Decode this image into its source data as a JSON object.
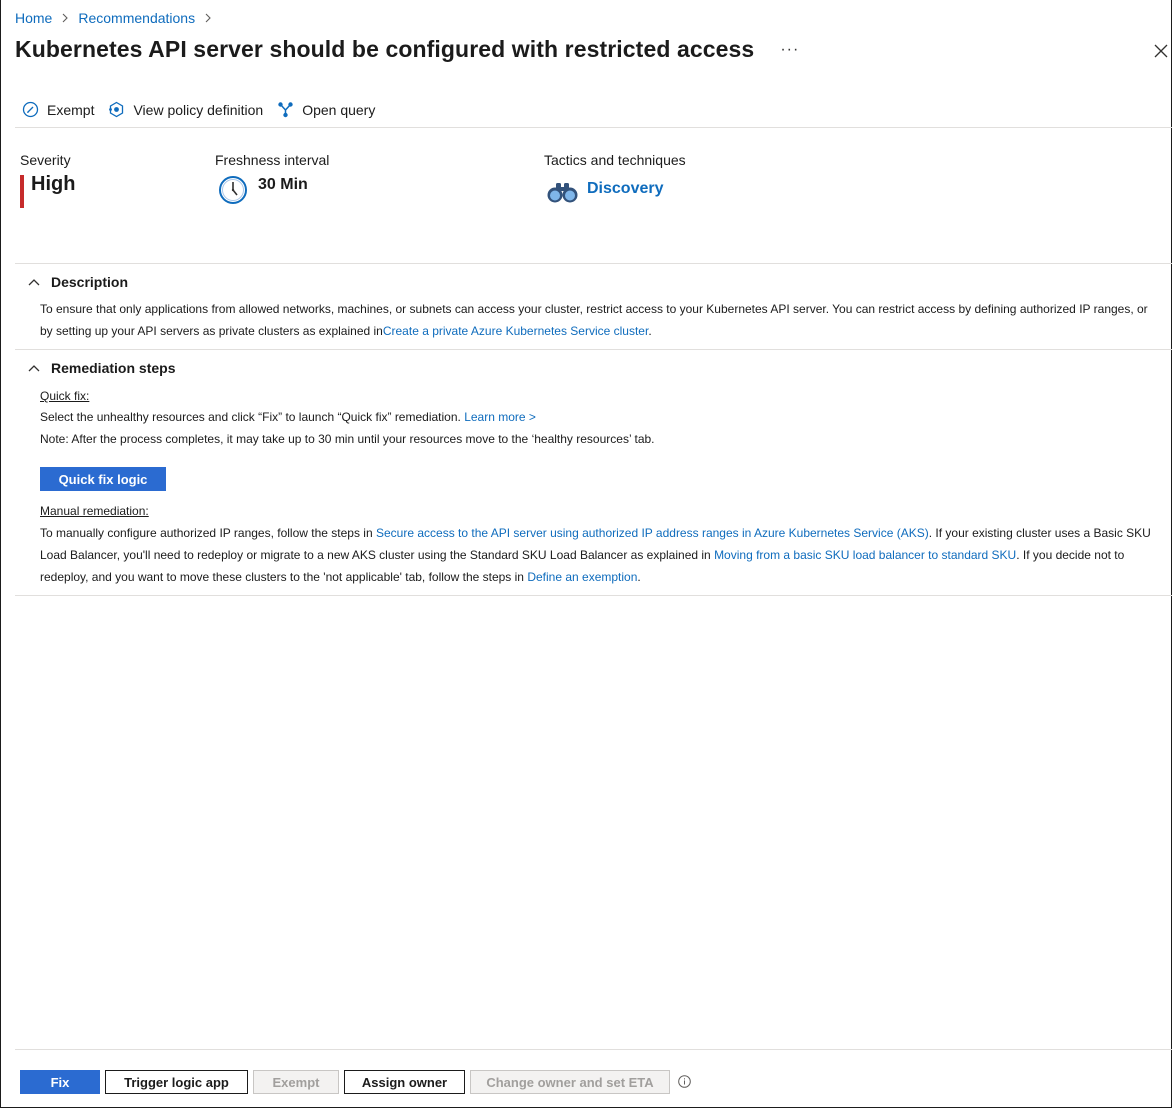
{
  "breadcrumb": {
    "home": "Home",
    "recommendations": "Recommendations"
  },
  "title": "Kubernetes API server should be configured with restricted access",
  "more_label": "···",
  "toolbar": {
    "exempt": "Exempt",
    "view_policy": "View policy definition",
    "open_query": "Open query"
  },
  "info": {
    "severity_label": "Severity",
    "severity_value": "High",
    "freshness_label": "Freshness interval",
    "freshness_value": "30 Min",
    "tactics_label": "Tactics and techniques",
    "tactics_value": "Discovery"
  },
  "description": {
    "heading": "Description",
    "text": "To ensure that only applications from allowed networks, machines, or subnets can access your cluster, restrict access to your Kubernetes API server. You can restrict access by defining authorized IP ranges, or by setting up your API servers as private clusters as explained in",
    "link": "Create a private Azure Kubernetes Service cluster",
    "end": "."
  },
  "remediation": {
    "heading": "Remediation steps",
    "quick_fix_label": "Quick fix:",
    "quick_fix_text": "Select the unhealthy resources and click “Fix” to launch “Quick fix” remediation.",
    "learn_more": "Learn more >",
    "note": "Note: After the process completes, it may take up to 30 min until your resources move to the ‘healthy resources’ tab.",
    "quick_fix_button": "Quick fix logic",
    "manual_label": "Manual remediation:",
    "manual_text_1": "To manually configure authorized IP ranges, follow the steps in",
    "manual_link_1": "Secure access to the API server using authorized IP address ranges in Azure Kubernetes Service (AKS)",
    "manual_text_2": ". If your existing cluster uses a Basic SKU Load Balancer, you'll need to redeploy or migrate to a new AKS cluster using the Standard SKU Load Balancer as explained in",
    "manual_link_2": "Moving from a basic SKU load balancer to standard SKU",
    "manual_text_3": ". If you decide not to redeploy, and you want to move these clusters to the 'not applicable' tab, follow the steps in",
    "manual_link_3": "Define an exemption",
    "manual_end": "."
  },
  "actions": {
    "fix": "Fix",
    "trigger_logic_app": "Trigger logic app",
    "exempt": "Exempt",
    "assign_owner": "Assign owner",
    "change_owner": "Change owner and set ETA"
  },
  "colors": {
    "link": "#0f6cbd",
    "primary_button": "#2b6bd1",
    "severity_high": "#c62b2b"
  }
}
